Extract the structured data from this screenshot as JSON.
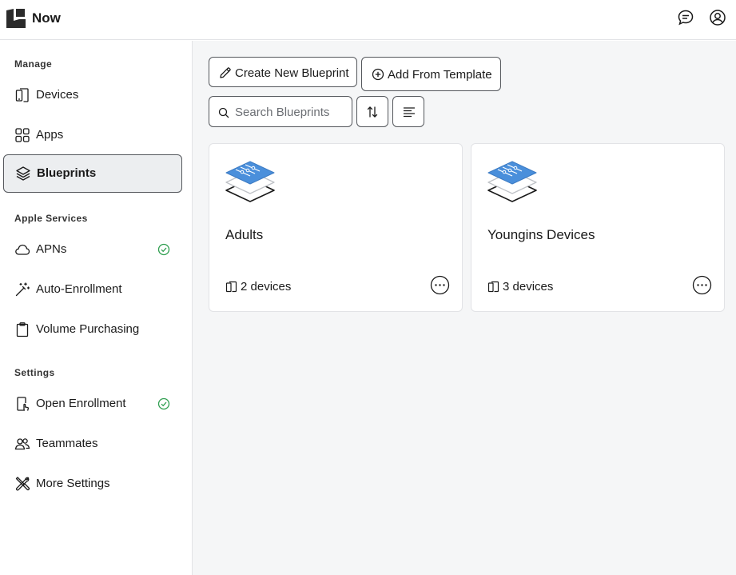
{
  "header": {
    "app_title": "Now",
    "icons": [
      "logo-icon",
      "chat-icon",
      "account-icon"
    ]
  },
  "sidebar": {
    "sections": [
      {
        "label": "Manage",
        "items": [
          {
            "label": "Devices",
            "icon": "devices-icon"
          },
          {
            "label": "Apps",
            "icon": "apps-grid-icon"
          },
          {
            "label": "Blueprints",
            "icon": "layers-icon",
            "active": true
          }
        ]
      },
      {
        "label": "Apple Services",
        "items": [
          {
            "label": "APNs",
            "icon": "cloud-icon",
            "status": "check"
          },
          {
            "label": "Auto-Enrollment",
            "icon": "magic-wand-icon"
          },
          {
            "label": "Volume Purchasing",
            "icon": "clipboard-icon"
          }
        ]
      },
      {
        "label": "Settings",
        "items": [
          {
            "label": "Open Enrollment",
            "icon": "phone-enroll-icon",
            "status": "check"
          },
          {
            "label": "Teammates",
            "icon": "people-icon"
          },
          {
            "label": "More Settings",
            "icon": "tools-icon"
          }
        ]
      }
    ],
    "status_color": "#2e9e4f"
  },
  "toolbar": {
    "create_label": "Create New Blueprint",
    "template_label": "Add From Template",
    "search_placeholder": "Search Blueprints",
    "search_value": ""
  },
  "blueprints": [
    {
      "name": "Adults",
      "devices": "2 devices"
    },
    {
      "name": "Youngins Devices",
      "devices": "3 devices"
    }
  ],
  "colors": {
    "accent_blue": "#4a8fdb",
    "border": "#54575c",
    "main_bg": "#f5f6f7"
  }
}
